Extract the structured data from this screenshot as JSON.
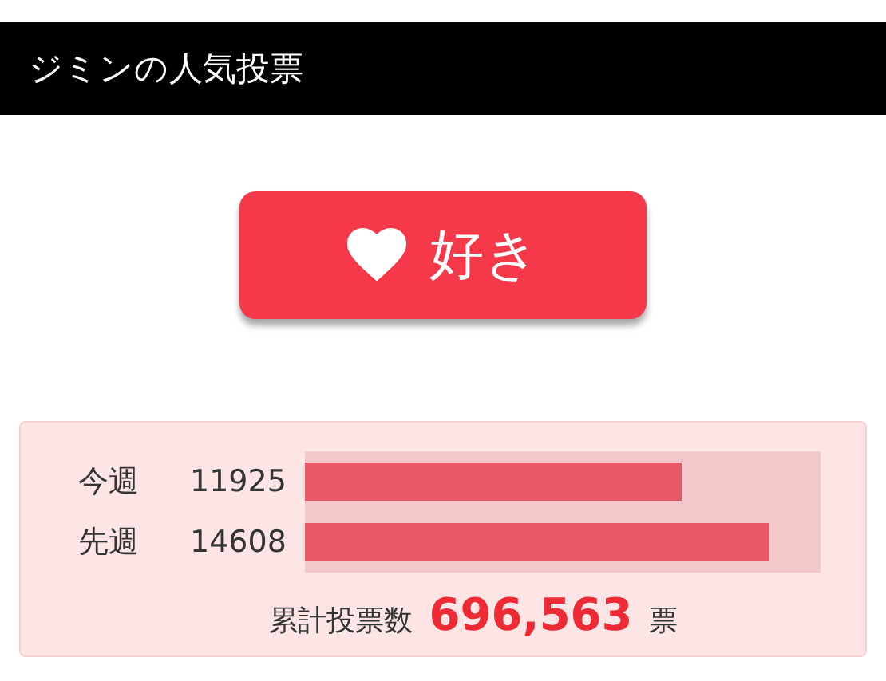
{
  "header": {
    "title": "ジミンの人気投票"
  },
  "like_button": {
    "label": "好き"
  },
  "weeks": [
    {
      "label": "今週",
      "count": "11925",
      "level": 0.73
    },
    {
      "label": "先週",
      "count": "14608",
      "level": 0.9
    }
  ],
  "total": {
    "label": "累計投票数",
    "value": "696,563",
    "unit": "票"
  }
}
